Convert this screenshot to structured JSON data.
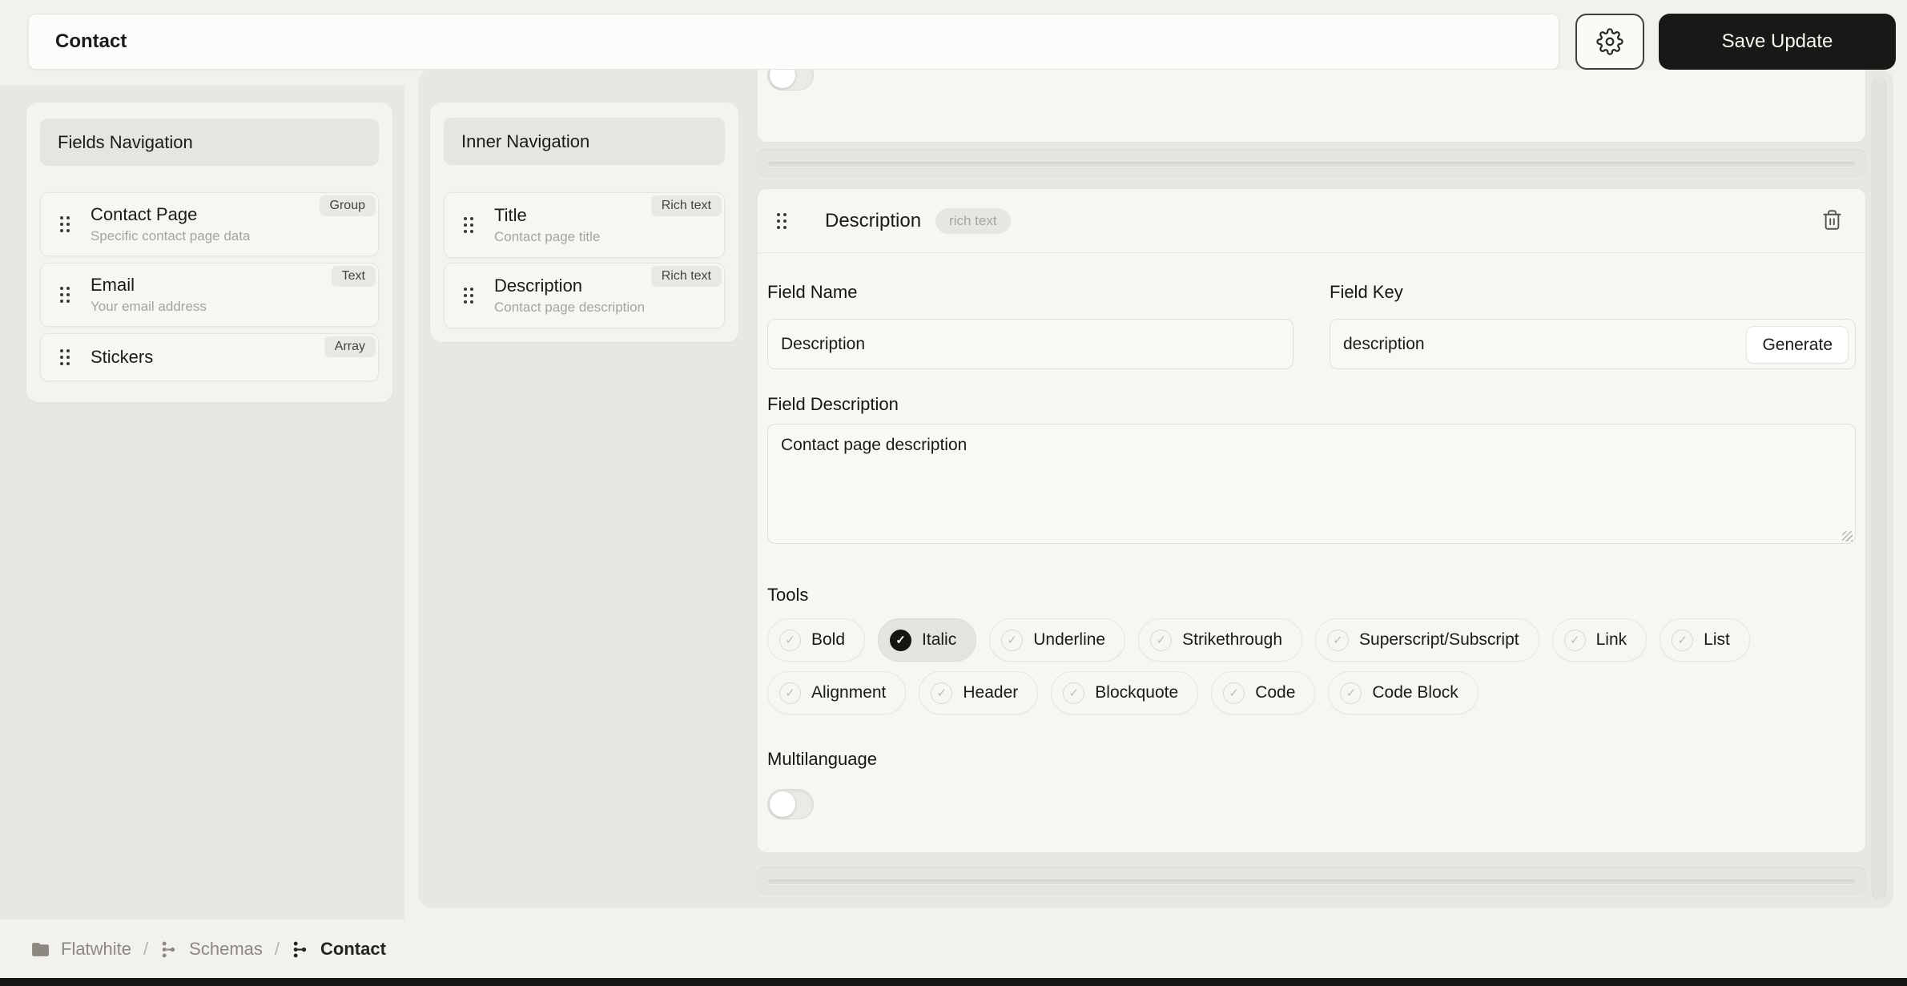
{
  "topbar": {
    "title": "Contact",
    "save_label": "Save Update"
  },
  "fields_navigation": {
    "title": "Fields Navigation",
    "items": [
      {
        "name": "Contact Page",
        "description": "Specific contact page data",
        "type": "Group"
      },
      {
        "name": "Email",
        "description": "Your email address",
        "type": "Text"
      },
      {
        "name": "Stickers",
        "description": "",
        "type": "Array"
      }
    ]
  },
  "inner_navigation": {
    "title": "Inner Navigation",
    "items": [
      {
        "name": "Title",
        "description": "Contact page title",
        "type": "Rich text"
      },
      {
        "name": "Description",
        "description": "Contact page description",
        "type": "Rich text"
      }
    ]
  },
  "field_editor": {
    "title": "Description",
    "type_badge": "rich text",
    "field_name_label": "Field Name",
    "field_name_value": "Description",
    "field_key_label": "Field Key",
    "field_key_value": "description",
    "generate_label": "Generate",
    "field_description_label": "Field Description",
    "field_description_value": "Contact page description",
    "tools_label": "Tools",
    "tools": [
      {
        "label": "Bold",
        "checked": false
      },
      {
        "label": "Italic",
        "checked": true
      },
      {
        "label": "Underline",
        "checked": false
      },
      {
        "label": "Strikethrough",
        "checked": false
      },
      {
        "label": "Superscript/Subscript",
        "checked": false
      },
      {
        "label": "Link",
        "checked": false
      },
      {
        "label": "List",
        "checked": false
      },
      {
        "label": "Alignment",
        "checked": false
      }
    ],
    "tools_row2": [
      {
        "label": "Header",
        "checked": false
      },
      {
        "label": "Blockquote",
        "checked": false
      },
      {
        "label": "Code",
        "checked": false
      },
      {
        "label": "Code Block",
        "checked": false
      }
    ],
    "multilanguage_label": "Multilanguage",
    "multilanguage_on": false
  },
  "breadcrumb": {
    "separator": "/",
    "items": [
      {
        "label": "Flatwhite",
        "icon": "folder-icon",
        "active": false
      },
      {
        "label": "Schemas",
        "icon": "schema-icon",
        "active": false
      },
      {
        "label": "Contact",
        "icon": "schema-icon",
        "active": true
      }
    ]
  },
  "icons": {
    "settings": "gear-icon",
    "delete_field": "trash-icon",
    "drag": "drag-handle-icon",
    "tool_check": "check-icon",
    "check_glyph": "✓"
  },
  "colors": {
    "accent_dark": "#191816",
    "panel_gray": "#e9e7e2",
    "card_light": "#f8f6f2",
    "text_secondary": "#a6a49e"
  }
}
